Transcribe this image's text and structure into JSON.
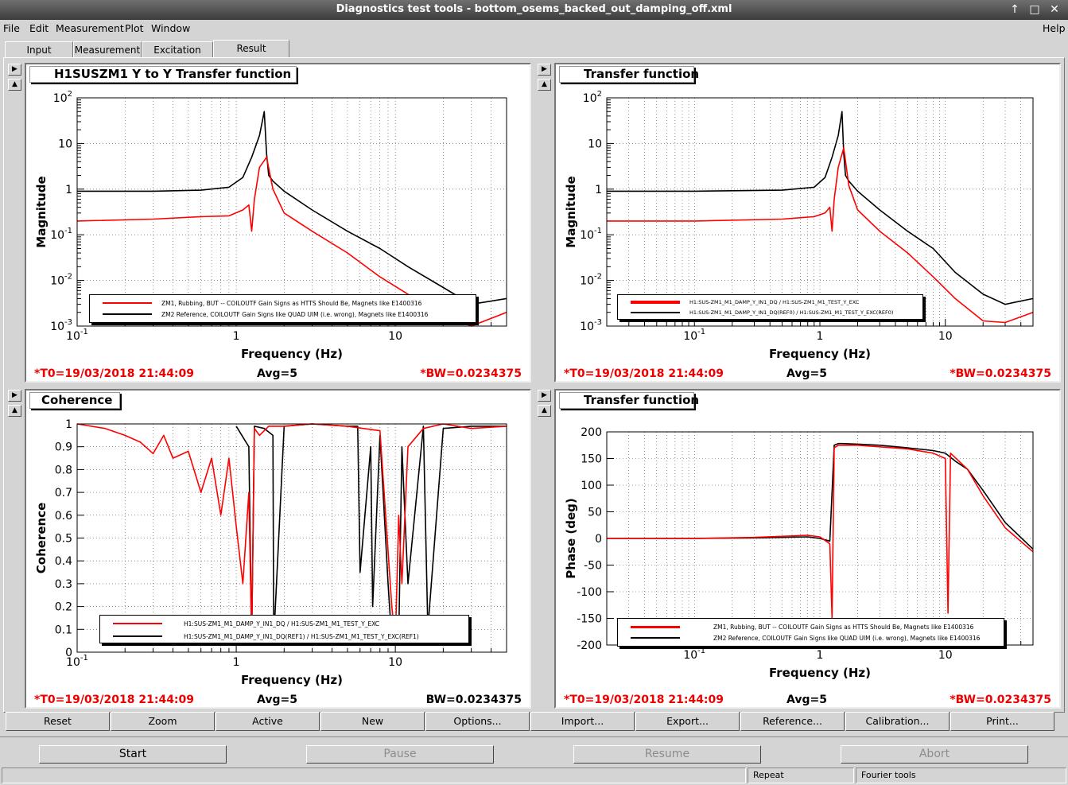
{
  "window": {
    "title": "Diagnostics test tools - bottom_osems_backed_out_damping_off.xml",
    "up_glyph": "↑",
    "max_glyph": "□",
    "close_glyph": "✕"
  },
  "menu": {
    "file": "File",
    "edit": "Edit",
    "measurement": "Measurement",
    "plot": "Plot",
    "window": "Window",
    "help": "Help"
  },
  "tabs": [
    {
      "label": "Input"
    },
    {
      "label": "Measurement"
    },
    {
      "label": "Excitation"
    },
    {
      "label": "Result"
    }
  ],
  "colors": {
    "series_red": "#ff0000",
    "series_black": "#000000",
    "footer_red": "#e00000"
  },
  "panes": [
    {
      "title": "H1SUSZM1 Y to Y Transfer function",
      "footer": {
        "t0": "*T0=19/03/2018 21:44:09",
        "avg": "Avg=5",
        "bw": "*BW=0.0234375"
      },
      "legend": [
        {
          "label": "ZM1, Rubbing, BUT -- COILOUTF Gain Signs as HTTS Should Be, Magnets like E1400316"
        },
        {
          "label": "ZM2 Reference, COILOUTF Gain Signs like QUAD UIM (i.e. wrong), Magnets like E1400316"
        }
      ]
    },
    {
      "title": "Transfer function",
      "footer": {
        "t0": "*T0=19/03/2018 21:44:09",
        "avg": "Avg=5",
        "bw": "*BW=0.0234375"
      },
      "legend": [
        {
          "label": "H1:SUS-ZM1_M1_DAMP_Y_IN1_DQ / H1:SUS-ZM1_M1_TEST_Y_EXC"
        },
        {
          "label": "H1:SUS-ZM1_M1_DAMP_Y_IN1_DQ(REF0) / H1:SUS-ZM1_M1_TEST_Y_EXC(REF0)"
        }
      ]
    },
    {
      "title": "Coherence",
      "footer": {
        "t0": "*T0=19/03/2018 21:44:09",
        "avg": "Avg=5",
        "bw": "BW=0.0234375"
      },
      "legend": [
        {
          "label": "H1:SUS-ZM1_M1_DAMP_Y_IN1_DQ / H1:SUS-ZM1_M1_TEST_Y_EXC"
        },
        {
          "label": "H1:SUS-ZM1_M1_DAMP_Y_IN1_DQ(REF1) / H1:SUS-ZM1_M1_TEST_Y_EXC(REF1)"
        }
      ]
    },
    {
      "title": "Transfer function",
      "footer": {
        "t0": "*T0=19/03/2018 21:44:09",
        "avg": "Avg=5",
        "bw": "*BW=0.0234375"
      },
      "legend": [
        {
          "label": "ZM1, Rubbing, BUT -- COILOUTF Gain Signs as HTTS Should Be, Magnets like E1400316"
        },
        {
          "label": "ZM2 Reference, COILOUTF Gain Signs like QUAD UIM (i.e. wrong), Magnets like E1400316"
        }
      ]
    }
  ],
  "toolbar": [
    "Reset",
    "Zoom",
    "Active",
    "New",
    "Options...",
    "Import...",
    "Export...",
    "Reference...",
    "Calibration...",
    "Print..."
  ],
  "bottom": {
    "start": "Start",
    "pause": "Pause",
    "resume": "Resume",
    "abort": "Abort"
  },
  "status": {
    "repeat": "Repeat",
    "fourier": "Fourier tools"
  },
  "chart_data": [
    {
      "type": "line",
      "xscale": "log",
      "yscale": "log",
      "xlim": [
        0.1,
        50
      ],
      "ylim": [
        0.001,
        100
      ],
      "xlabel": "Frequency (Hz)",
      "ylabel": "Magnitude",
      "xticks": [
        {
          "v": 0.1,
          "b": "10",
          "e": "-1"
        },
        {
          "v": 1,
          "b": "1",
          "e": ""
        },
        {
          "v": 10,
          "b": "10",
          "e": ""
        }
      ],
      "yticks": [
        {
          "v": 0.001,
          "b": "10",
          "e": "-3"
        },
        {
          "v": 0.01,
          "b": "10",
          "e": "-2"
        },
        {
          "v": 0.1,
          "b": "10",
          "e": "-1"
        },
        {
          "v": 1,
          "b": "1",
          "e": ""
        },
        {
          "v": 10,
          "b": "10",
          "e": ""
        },
        {
          "v": 100,
          "b": "10",
          "e": "2"
        }
      ],
      "grid": true,
      "legend_position": "bottom-center",
      "series": [
        {
          "color": "red",
          "x": [
            0.1,
            0.3,
            0.6,
            0.9,
            1.1,
            1.2,
            1.25,
            1.3,
            1.4,
            1.55,
            1.7,
            2,
            3,
            5,
            8,
            12,
            20,
            30,
            50
          ],
          "y": [
            0.2,
            0.22,
            0.25,
            0.26,
            0.35,
            0.45,
            0.12,
            0.6,
            3,
            5,
            1,
            0.3,
            0.12,
            0.04,
            0.012,
            0.005,
            0.0018,
            0.001,
            0.002
          ]
        },
        {
          "color": "black",
          "x": [
            0.1,
            0.3,
            0.6,
            0.9,
            1.1,
            1.25,
            1.4,
            1.5,
            1.55,
            1.6,
            1.7,
            2,
            3,
            5,
            8,
            12,
            20,
            30,
            50
          ],
          "y": [
            0.9,
            0.9,
            0.95,
            1.1,
            1.8,
            5,
            15,
            50,
            6,
            2,
            1.5,
            0.9,
            0.35,
            0.12,
            0.05,
            0.02,
            0.007,
            0.003,
            0.004
          ]
        }
      ]
    },
    {
      "type": "line",
      "xscale": "log",
      "yscale": "log",
      "xlim": [
        0.02,
        50
      ],
      "ylim": [
        0.001,
        100
      ],
      "xlabel": "Frequency (Hz)",
      "ylabel": "Magnitude",
      "xticks": [
        {
          "v": 0.1,
          "b": "10",
          "e": "-1"
        },
        {
          "v": 1,
          "b": "1",
          "e": ""
        },
        {
          "v": 10,
          "b": "10",
          "e": ""
        }
      ],
      "yticks": [
        {
          "v": 0.001,
          "b": "10",
          "e": "-3"
        },
        {
          "v": 0.01,
          "b": "10",
          "e": "-2"
        },
        {
          "v": 0.1,
          "b": "10",
          "e": "-1"
        },
        {
          "v": 1,
          "b": "1",
          "e": ""
        },
        {
          "v": 10,
          "b": "10",
          "e": ""
        },
        {
          "v": 100,
          "b": "10",
          "e": "2"
        }
      ],
      "grid": true,
      "legend_position": "bottom-center",
      "series": [
        {
          "color": "red",
          "x": [
            0.02,
            0.1,
            0.5,
            0.9,
            1.1,
            1.2,
            1.25,
            1.3,
            1.4,
            1.55,
            1.7,
            2,
            3,
            5,
            8,
            12,
            20,
            30,
            50
          ],
          "y": [
            0.2,
            0.2,
            0.22,
            0.25,
            0.3,
            0.4,
            0.12,
            0.6,
            3,
            8,
            1.2,
            0.35,
            0.12,
            0.04,
            0.012,
            0.004,
            0.0013,
            0.0012,
            0.002
          ]
        },
        {
          "color": "black",
          "x": [
            0.02,
            0.1,
            0.5,
            0.9,
            1.1,
            1.25,
            1.4,
            1.5,
            1.55,
            1.6,
            1.7,
            2,
            3,
            5,
            8,
            12,
            20,
            30,
            50
          ],
          "y": [
            0.9,
            0.9,
            0.95,
            1.1,
            1.8,
            5,
            15,
            50,
            6,
            2,
            1.5,
            0.9,
            0.35,
            0.12,
            0.05,
            0.015,
            0.005,
            0.003,
            0.004
          ]
        }
      ]
    },
    {
      "type": "line",
      "xscale": "log",
      "yscale": "linear",
      "xlim": [
        0.1,
        50
      ],
      "ylim": [
        0,
        1
      ],
      "xlabel": "Frequency (Hz)",
      "ylabel": "Coherence",
      "xticks": [
        {
          "v": 0.1,
          "b": "10",
          "e": "-1"
        },
        {
          "v": 1,
          "b": "1",
          "e": ""
        },
        {
          "v": 10,
          "b": "10",
          "e": ""
        }
      ],
      "yticks": [
        {
          "v": 0,
          "b": "0",
          "e": ""
        },
        {
          "v": 0.1,
          "b": "0.1",
          "e": ""
        },
        {
          "v": 0.2,
          "b": "0.2",
          "e": ""
        },
        {
          "v": 0.3,
          "b": "0.3",
          "e": ""
        },
        {
          "v": 0.4,
          "b": "0.4",
          "e": ""
        },
        {
          "v": 0.5,
          "b": "0.5",
          "e": ""
        },
        {
          "v": 0.6,
          "b": "0.6",
          "e": ""
        },
        {
          "v": 0.7,
          "b": "0.7",
          "e": ""
        },
        {
          "v": 0.8,
          "b": "0.8",
          "e": ""
        },
        {
          "v": 0.9,
          "b": "0.9",
          "e": ""
        },
        {
          "v": 1,
          "b": "1",
          "e": ""
        }
      ],
      "grid": true,
      "legend_position": "bottom-center",
      "series": [
        {
          "color": "red",
          "x": [
            0.1,
            0.15,
            0.2,
            0.25,
            0.3,
            0.35,
            0.4,
            0.5,
            0.6,
            0.7,
            0.8,
            0.9,
            1.0,
            1.1,
            1.2,
            1.25,
            1.3,
            1.4,
            1.6,
            2,
            3,
            5,
            8,
            9.5,
            10,
            10.5,
            11,
            12,
            15,
            20,
            30,
            50
          ],
          "y": [
            1,
            0.98,
            0.95,
            0.92,
            0.87,
            0.95,
            0.85,
            0.88,
            0.7,
            0.85,
            0.6,
            0.85,
            0.55,
            0.3,
            0.7,
            0.05,
            0.98,
            0.95,
            0.99,
            0.99,
            1,
            0.99,
            0.97,
            0.2,
            0.05,
            0.6,
            0.3,
            0.9,
            0.98,
            1,
            0.98,
            0.99
          ]
        },
        {
          "color": "black",
          "x": [
            1.0,
            1.2,
            1.25,
            1.3,
            1.5,
            1.7,
            1.72,
            2,
            3,
            5,
            5.8,
            6,
            7,
            7.2,
            8,
            9,
            9.5,
            10,
            10.5,
            11,
            12,
            15,
            16,
            20,
            30,
            50
          ],
          "y": [
            0.99,
            0.9,
            0.05,
            0.99,
            0.98,
            0.95,
            0.05,
            0.99,
            1,
            0.99,
            0.99,
            0.35,
            0.9,
            0.2,
            0.95,
            0.3,
            0.05,
            0.05,
            0.05,
            0.9,
            0.3,
            0.99,
            0.1,
            0.98,
            0.99,
            0.99
          ]
        }
      ]
    },
    {
      "type": "line",
      "xscale": "log",
      "yscale": "linear",
      "xlim": [
        0.02,
        50
      ],
      "ylim": [
        -200,
        200
      ],
      "xlabel": "Frequency (Hz)",
      "ylabel": "Phase (deg)",
      "xticks": [
        {
          "v": 0.1,
          "b": "10",
          "e": "-1"
        },
        {
          "v": 1,
          "b": "1",
          "e": ""
        },
        {
          "v": 10,
          "b": "10",
          "e": ""
        }
      ],
      "yticks": [
        {
          "v": -200,
          "b": "-200",
          "e": ""
        },
        {
          "v": -150,
          "b": "-150",
          "e": ""
        },
        {
          "v": -100,
          "b": "-100",
          "e": ""
        },
        {
          "v": -50,
          "b": "-50",
          "e": ""
        },
        {
          "v": 0,
          "b": "0",
          "e": ""
        },
        {
          "v": 50,
          "b": "50",
          "e": ""
        },
        {
          "v": 100,
          "b": "100",
          "e": ""
        },
        {
          "v": 150,
          "b": "150",
          "e": ""
        },
        {
          "v": 200,
          "b": "200",
          "e": ""
        }
      ],
      "grid": true,
      "legend_position": "bottom-center",
      "series": [
        {
          "color": "red",
          "x": [
            0.02,
            0.1,
            0.3,
            0.5,
            0.8,
            1.0,
            1.2,
            1.25,
            1.3,
            1.4,
            1.5,
            2,
            3,
            5,
            8,
            10,
            10.5,
            11,
            15,
            20,
            30,
            50
          ],
          "y": [
            0,
            0,
            2,
            4,
            6,
            3,
            -10,
            -150,
            170,
            175,
            175,
            175,
            172,
            168,
            160,
            150,
            -140,
            160,
            130,
            80,
            20,
            -25
          ]
        },
        {
          "color": "black",
          "x": [
            0.02,
            0.1,
            0.3,
            0.5,
            0.8,
            1.0,
            1.2,
            1.3,
            1.4,
            1.5,
            2,
            3,
            5,
            8,
            10,
            12,
            15,
            20,
            30,
            50
          ],
          "y": [
            0,
            0,
            1,
            2,
            3,
            0,
            -5,
            175,
            178,
            178,
            177,
            175,
            170,
            165,
            160,
            145,
            130,
            90,
            30,
            -20
          ]
        }
      ]
    }
  ]
}
